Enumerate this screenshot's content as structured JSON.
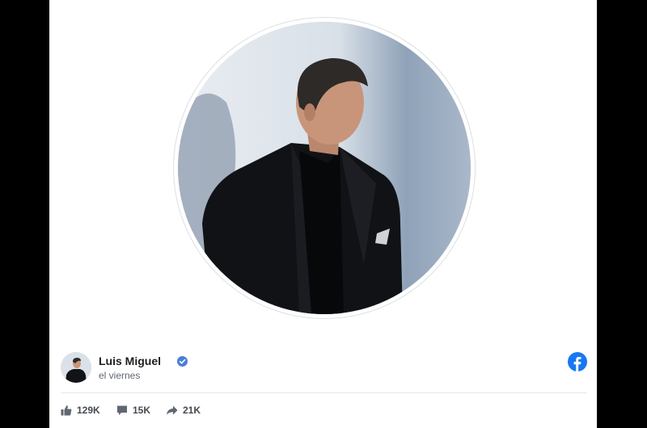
{
  "post": {
    "author": "Luis Miguel",
    "time": "el viernes"
  },
  "stats": {
    "likes": "129K",
    "comments": "15K",
    "shares": "21K"
  },
  "icons": {
    "verified": "verified-badge-icon",
    "network": "facebook-logo-icon",
    "like": "thumbs-up-icon",
    "comment": "comment-bubble-icon",
    "share": "share-arrow-icon"
  },
  "colors": {
    "brand": "#1877f2",
    "verified": "#4a7fd6",
    "text_primary": "#1c1e21",
    "text_secondary": "#606770",
    "frame": "#000000"
  }
}
